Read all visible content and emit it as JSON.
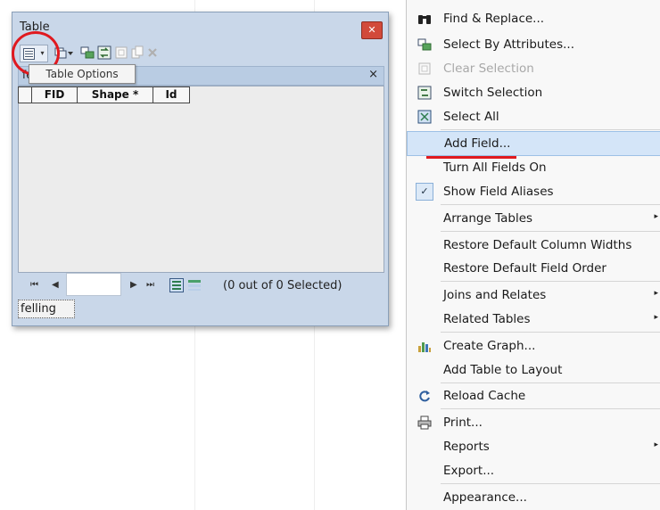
{
  "window": {
    "title": "Table",
    "close_glyph": "✕",
    "tab_name": "fel",
    "tab_close": "×",
    "tooltip": "Table Options",
    "columns": [
      "FID",
      "Shape *",
      "Id"
    ],
    "status": "(0 out of 0 Selected)",
    "table_tab": "felling",
    "nav": {
      "first": "⏮",
      "prev": "◀",
      "next": "▶",
      "last": "⏭"
    }
  },
  "menu": {
    "items": [
      {
        "label": "Find & Replace...",
        "icon": "binoculars-icon"
      },
      {
        "label": "Select By Attributes...",
        "icon": "select-attributes-icon"
      },
      {
        "label": "Clear Selection",
        "icon": "clear-selection-icon",
        "disabled": true
      },
      {
        "label": "Switch Selection",
        "icon": "switch-selection-icon"
      },
      {
        "label": "Select All",
        "icon": "select-all-icon"
      },
      {
        "label": "Add Field...",
        "highlighted": true
      },
      {
        "label": "Turn All Fields On"
      },
      {
        "label": "Show Field Aliases",
        "checked": true
      },
      {
        "label": "Arrange Tables",
        "submenu": true
      },
      {
        "label": "Restore Default Column Widths"
      },
      {
        "label": "Restore Default Field Order"
      },
      {
        "label": "Joins and Relates",
        "submenu": true
      },
      {
        "label": "Related Tables",
        "submenu": true
      },
      {
        "label": "Create Graph...",
        "icon": "graph-icon"
      },
      {
        "label": "Add Table to Layout"
      },
      {
        "label": "Reload Cache",
        "icon": "reload-icon"
      },
      {
        "label": "Print...",
        "icon": "printer-icon"
      },
      {
        "label": "Reports",
        "submenu": true
      },
      {
        "label": "Export..."
      },
      {
        "label": "Appearance..."
      }
    ],
    "submenu_arrow": "▸",
    "check_glyph": "✓"
  },
  "colors": {
    "window_frame": "#c9d7e9",
    "highlight": "#d4e5f8",
    "annotation_red": "#e0191f"
  }
}
